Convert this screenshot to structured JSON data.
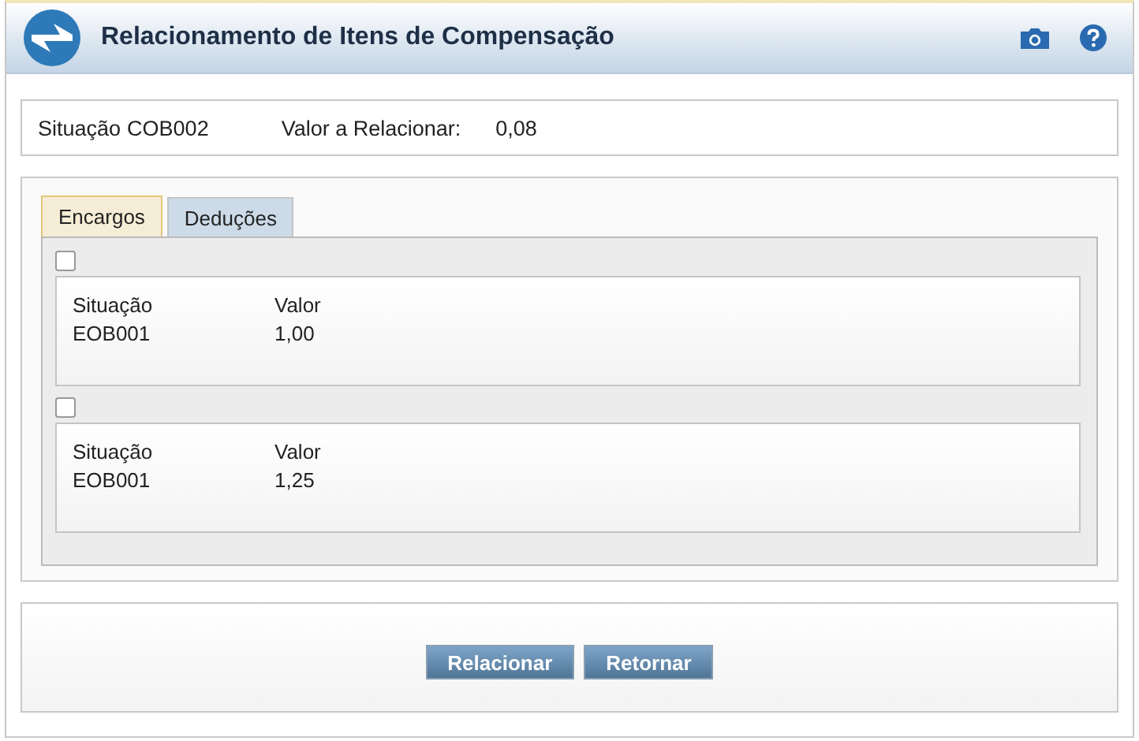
{
  "window": {
    "title": "Relacionamento de Itens de Compensação"
  },
  "summary": {
    "situacao_label": "Situação",
    "situacao_value": "COB002",
    "valor_label": "Valor a Relacionar:",
    "valor_value": "0,08"
  },
  "tabs": [
    {
      "label": "Encargos",
      "selected": true
    },
    {
      "label": "Deduções",
      "selected": false
    }
  ],
  "items": [
    {
      "checked": false,
      "situacao_label": "Situação",
      "situacao_value": "EOB001",
      "valor_label": "Valor",
      "valor_value": "1,00"
    },
    {
      "checked": false,
      "situacao_label": "Situação",
      "situacao_value": "EOB001",
      "valor_label": "Valor",
      "valor_value": "1,25"
    }
  ],
  "buttons": [
    "Relacionar",
    "Retornar"
  ]
}
